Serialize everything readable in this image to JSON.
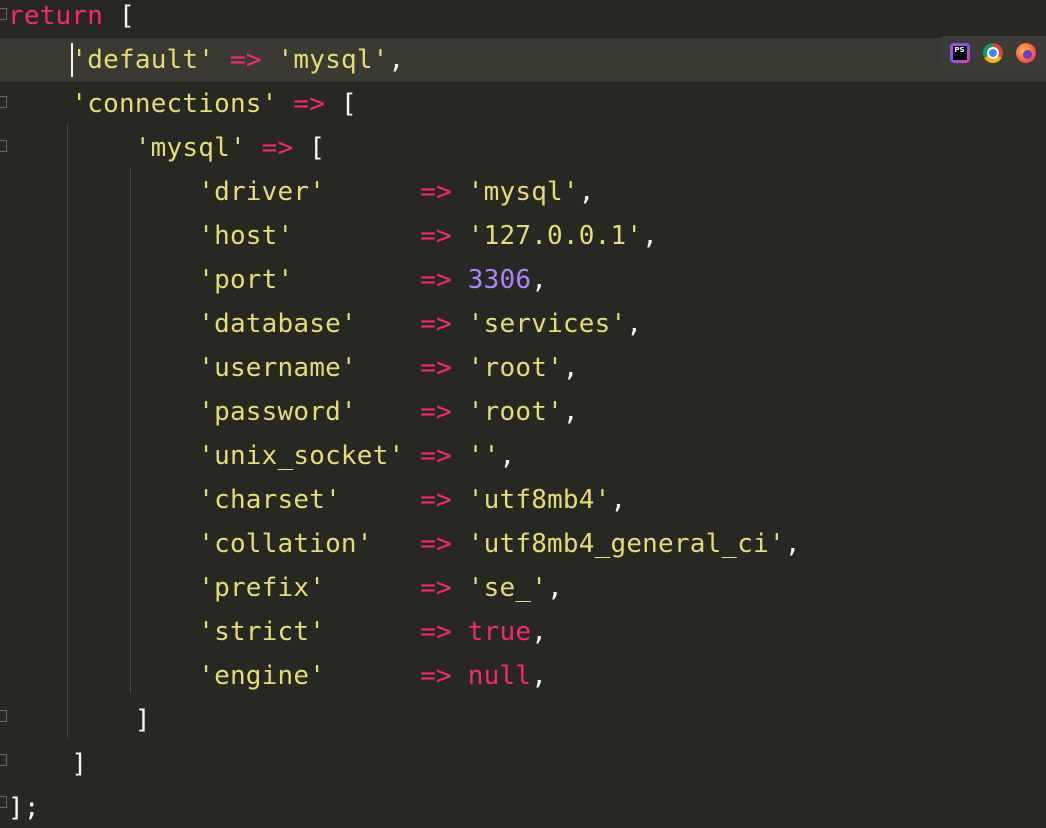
{
  "editor": {
    "theme_colors": {
      "background": "#272822",
      "keyword": "#f92672",
      "string": "#e6db74",
      "number": "#ae81ff",
      "punctuation": "#f8f8f2"
    },
    "lines": [
      {
        "tokens": [
          {
            "t": "kw",
            "v": "return"
          },
          {
            "t": "punc",
            "v": " ["
          }
        ]
      },
      {
        "tokens": [
          {
            "t": "punc",
            "v": "    "
          },
          {
            "t": "str",
            "v": "'default'"
          },
          {
            "t": "punc",
            "v": " "
          },
          {
            "t": "kw",
            "v": "=>"
          },
          {
            "t": "punc",
            "v": " "
          },
          {
            "t": "str",
            "v": "'mysql'"
          },
          {
            "t": "punc",
            "v": ","
          }
        ]
      },
      {
        "tokens": [
          {
            "t": "punc",
            "v": "    "
          },
          {
            "t": "str",
            "v": "'connections'"
          },
          {
            "t": "punc",
            "v": " "
          },
          {
            "t": "kw",
            "v": "=>"
          },
          {
            "t": "punc",
            "v": " ["
          }
        ]
      },
      {
        "tokens": [
          {
            "t": "punc",
            "v": "        "
          },
          {
            "t": "str",
            "v": "'mysql'"
          },
          {
            "t": "punc",
            "v": " "
          },
          {
            "t": "kw",
            "v": "=>"
          },
          {
            "t": "punc",
            "v": " ["
          }
        ]
      },
      {
        "tokens": [
          {
            "t": "punc",
            "v": "            "
          },
          {
            "t": "str",
            "v": "'driver'"
          },
          {
            "t": "punc",
            "v": "      "
          },
          {
            "t": "kw",
            "v": "=>"
          },
          {
            "t": "punc",
            "v": " "
          },
          {
            "t": "str",
            "v": "'mysql'"
          },
          {
            "t": "punc",
            "v": ","
          }
        ]
      },
      {
        "tokens": [
          {
            "t": "punc",
            "v": "            "
          },
          {
            "t": "str",
            "v": "'host'"
          },
          {
            "t": "punc",
            "v": "        "
          },
          {
            "t": "kw",
            "v": "=>"
          },
          {
            "t": "punc",
            "v": " "
          },
          {
            "t": "str",
            "v": "'127.0.0.1'"
          },
          {
            "t": "punc",
            "v": ","
          }
        ]
      },
      {
        "tokens": [
          {
            "t": "punc",
            "v": "            "
          },
          {
            "t": "str",
            "v": "'port'"
          },
          {
            "t": "punc",
            "v": "        "
          },
          {
            "t": "kw",
            "v": "=>"
          },
          {
            "t": "punc",
            "v": " "
          },
          {
            "t": "num",
            "v": "3306"
          },
          {
            "t": "punc",
            "v": ","
          }
        ]
      },
      {
        "tokens": [
          {
            "t": "punc",
            "v": "            "
          },
          {
            "t": "str",
            "v": "'database'"
          },
          {
            "t": "punc",
            "v": "    "
          },
          {
            "t": "kw",
            "v": "=>"
          },
          {
            "t": "punc",
            "v": " "
          },
          {
            "t": "str",
            "v": "'services'"
          },
          {
            "t": "punc",
            "v": ","
          }
        ]
      },
      {
        "tokens": [
          {
            "t": "punc",
            "v": "            "
          },
          {
            "t": "str",
            "v": "'username'"
          },
          {
            "t": "punc",
            "v": "    "
          },
          {
            "t": "kw",
            "v": "=>"
          },
          {
            "t": "punc",
            "v": " "
          },
          {
            "t": "str",
            "v": "'root'"
          },
          {
            "t": "punc",
            "v": ","
          }
        ]
      },
      {
        "tokens": [
          {
            "t": "punc",
            "v": "            "
          },
          {
            "t": "str",
            "v": "'password'"
          },
          {
            "t": "punc",
            "v": "    "
          },
          {
            "t": "kw",
            "v": "=>"
          },
          {
            "t": "punc",
            "v": " "
          },
          {
            "t": "str",
            "v": "'root'"
          },
          {
            "t": "punc",
            "v": ","
          }
        ]
      },
      {
        "tokens": [
          {
            "t": "punc",
            "v": "            "
          },
          {
            "t": "str",
            "v": "'unix_socket'"
          },
          {
            "t": "punc",
            "v": " "
          },
          {
            "t": "kw",
            "v": "=>"
          },
          {
            "t": "punc",
            "v": " "
          },
          {
            "t": "str",
            "v": "''"
          },
          {
            "t": "punc",
            "v": ","
          }
        ]
      },
      {
        "tokens": [
          {
            "t": "punc",
            "v": "            "
          },
          {
            "t": "str",
            "v": "'charset'"
          },
          {
            "t": "punc",
            "v": "     "
          },
          {
            "t": "kw",
            "v": "=>"
          },
          {
            "t": "punc",
            "v": " "
          },
          {
            "t": "str",
            "v": "'utf8mb4'"
          },
          {
            "t": "punc",
            "v": ","
          }
        ]
      },
      {
        "tokens": [
          {
            "t": "punc",
            "v": "            "
          },
          {
            "t": "str",
            "v": "'collation'"
          },
          {
            "t": "punc",
            "v": "   "
          },
          {
            "t": "kw",
            "v": "=>"
          },
          {
            "t": "punc",
            "v": " "
          },
          {
            "t": "str",
            "v": "'utf8mb4_general_ci'"
          },
          {
            "t": "punc",
            "v": ","
          }
        ]
      },
      {
        "tokens": [
          {
            "t": "punc",
            "v": "            "
          },
          {
            "t": "str",
            "v": "'prefix'"
          },
          {
            "t": "punc",
            "v": "      "
          },
          {
            "t": "kw",
            "v": "=>"
          },
          {
            "t": "punc",
            "v": " "
          },
          {
            "t": "str",
            "v": "'se_'"
          },
          {
            "t": "punc",
            "v": ","
          }
        ]
      },
      {
        "tokens": [
          {
            "t": "punc",
            "v": "            "
          },
          {
            "t": "str",
            "v": "'strict'"
          },
          {
            "t": "punc",
            "v": "      "
          },
          {
            "t": "kw",
            "v": "=>"
          },
          {
            "t": "punc",
            "v": " "
          },
          {
            "t": "kw",
            "v": "true"
          },
          {
            "t": "punc",
            "v": ","
          }
        ]
      },
      {
        "tokens": [
          {
            "t": "punc",
            "v": "            "
          },
          {
            "t": "str",
            "v": "'engine'"
          },
          {
            "t": "punc",
            "v": "      "
          },
          {
            "t": "kw",
            "v": "=>"
          },
          {
            "t": "punc",
            "v": " "
          },
          {
            "t": "kw",
            "v": "null"
          },
          {
            "t": "punc",
            "v": ","
          }
        ]
      },
      {
        "tokens": [
          {
            "t": "punc",
            "v": "        ]"
          }
        ]
      },
      {
        "tokens": [
          {
            "t": "punc",
            "v": "    ]"
          }
        ]
      },
      {
        "tokens": [
          {
            "t": "punc",
            "v": "];"
          }
        ]
      }
    ],
    "current_line_index": 1
  },
  "browser_bar": {
    "icons": [
      {
        "name": "phpstorm-icon",
        "label": "PS"
      },
      {
        "name": "chrome-icon",
        "label": ""
      },
      {
        "name": "firefox-icon",
        "label": ""
      }
    ]
  }
}
